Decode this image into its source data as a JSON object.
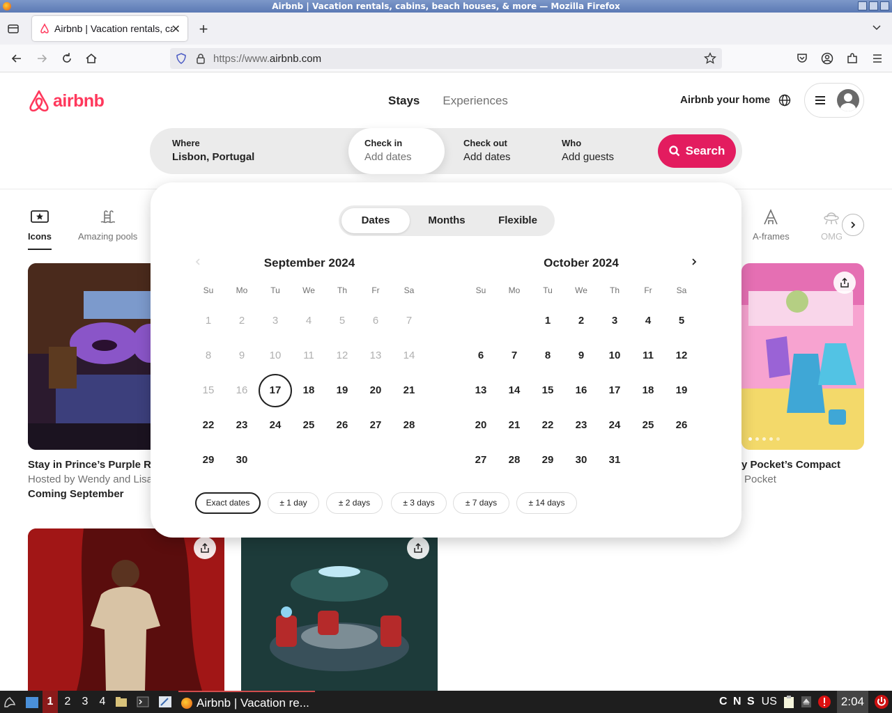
{
  "window": {
    "title": "Airbnb | Vacation rentals, cabins, beach houses, & more — Mozilla Firefox"
  },
  "browser": {
    "tab_title": "Airbnb | Vacation rentals, cabins, beach houses, & more",
    "url_prefix": "https://www.",
    "url_domain": "airbnb.com"
  },
  "header": {
    "logo_text": "airbnb",
    "nav": [
      "Stays",
      "Experiences"
    ],
    "host_link": "Airbnb your home"
  },
  "search": {
    "where_label": "Where",
    "where_value": "Lisbon, Portugal",
    "checkin_label": "Check in",
    "checkin_value": "Add dates",
    "checkout_label": "Check out",
    "checkout_value": "Add dates",
    "who_label": "Who",
    "who_value": "Add guests",
    "button": "Search"
  },
  "categories": {
    "left": [
      "Icons",
      "Amazing pools"
    ],
    "right": [
      "A-frames",
      "OMG!"
    ]
  },
  "picker": {
    "modes": [
      "Dates",
      "Months",
      "Flexible"
    ],
    "weekdays": [
      "Su",
      "Mo",
      "Tu",
      "We",
      "Th",
      "Fr",
      "Sa"
    ],
    "months": [
      {
        "title": "September 2024",
        "first_weekday": 0,
        "days": 30,
        "today": 17
      },
      {
        "title": "October 2024",
        "first_weekday": 2,
        "days": 31,
        "today": null
      }
    ],
    "flex_options": [
      "Exact dates",
      "± 1 day",
      "± 2 days",
      "± 3 days",
      "± 7 days",
      "± 14 days"
    ]
  },
  "listings": [
    {
      "title": "Stay in Prince’s Purple Rai",
      "host": "Hosted by Wendy and Lisa",
      "status": "Coming September"
    },
    {
      "title": "y Pocket’s Compact",
      "host": "Pocket"
    }
  ],
  "taskbar": {
    "workspaces": [
      "1",
      "2",
      "3",
      "4"
    ],
    "task_title": "Airbnb | Vacation re...",
    "indicators": "C N S",
    "layout": "US",
    "clock": "2:04"
  },
  "colors": {
    "brand": "#ff385c",
    "search_button": "#e31c5f"
  }
}
